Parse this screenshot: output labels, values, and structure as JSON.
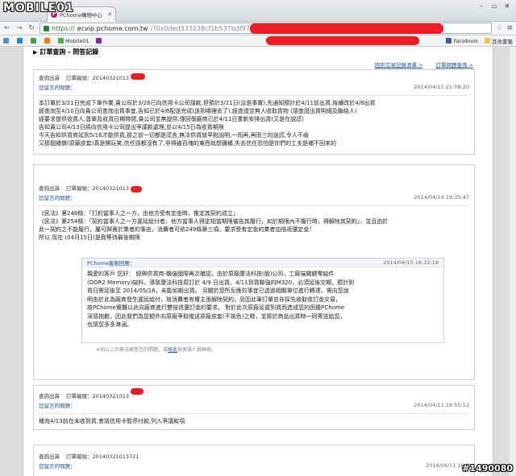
{
  "watermark": {
    "logo": "MOBILE01",
    "id": "#1490080"
  },
  "browser": {
    "tab_title": "PChome購物中心",
    "tab_favicon": "P",
    "url_scheme": "https://",
    "url_host": "ecvip.pchome.com.tw",
    "url_rest": "/?0x0ded333238cf1b537bdf971253aa19c2372a6d31ceef06fd727a6bd84c",
    "bookmarks": [
      {
        "label": "",
        "color": "#4a90d9"
      },
      {
        "label": "",
        "color": "#1e88e5"
      },
      {
        "label": "",
        "color": "#43a047"
      },
      {
        "label": "",
        "color": "#f57c00"
      },
      {
        "label": "Mobile01",
        "color": "#4caf50"
      },
      {
        "label": "",
        "color": "#8e24aa"
      },
      {
        "label": "Facebook",
        "color": "#3b5998"
      },
      {
        "label": "其他書籤",
        "color": "#f5c542"
      }
    ]
  },
  "page": {
    "title": "訂單查詢 - 問答記錄",
    "link_more": "回到交易記錄清單 >",
    "link_faq": "訂單問題查詢 >"
  },
  "cards": [
    {
      "order_label": "查詢出貨",
      "order_id_label": "訂單編號：20140321013",
      "question_label": "您留言的問題：",
      "timestamp": "2014/04/15 21:58:20",
      "lines": [
        "本訂單於3/21日完成下單作業,貴公司於3/26已向信用卡公司請款,但預計3/21日(這是事實),先通知預計於4/11前出貨,後續改於4/8出貨",
        "經查詢至4/10日向貴公司查詢出貨事宜,告知已於4/8配送完成(送到哪裡去了),經查證並無人收取貨物 (請查證出貨明細及聯絡人)",
        "經要求提供收貨人,簽單及收貨日期時間,貴公司並無提供,僅回復廠商已於4/11日重新安排出貨(又是在說謊)",
        "告知貴公司4/13日將向信用卡公司提出爭議款處理,並以4/15日為收貨期限",
        "今天告知供貨商延到5/16才能供貨,那之前一切都是謊言,無法供貨就早點說明,一而再,再而三的說謊,令人不齒",
        "又那個補償(原廠皮套)真是開玩笑,信任感都沒有了,非得幾百塊的東西就想彌補,失去信任恐怕是你們的工夫是補不回來的"
      ]
    },
    {
      "order_label": "查詢出貨",
      "order_id_label": "訂單編號：20140321013",
      "question_label": "您留言的問題：",
      "timestamp": "2014/04/14 19:35:47",
      "lines": [
        "《民法》第248條：「訂約當事人之一方，由他方受有定金時，推定其契約成立」",
        "《民法》第254條：「契約當事人之一方遲延給付者，他方當事人得定相當期限催告其履行，如於期限內不履行時，得解除其契約」，並且由於",
        "此一契約之不能履行，屬可歸責於業者的事由，消費者可依249條第三項，要求受有定金的業者加倍返還定金！",
        "所以 现在 (04月15日)是我等待最後期限"
      ],
      "reply": {
        "label": "PChome客服回應：",
        "timestamp": "2014/04/15 18:22:18",
        "lines": [
          "親愛的客戶 您好： 經與供貨商-聯強國際再次確認，由於原廠康法科技(股)公司，工廠端關鍵零組件",
          "(DDR2 Memory)缺料，導致康法科技原訂於 4/9 日出貨、4/11到貨聯強的M320，必須延後交期，預計到",
          "貨日需延後至 2014/05/16，未能如期出貨。 另關於您所反應的事宜已透過相關單位進行轉達，需向您說",
          "明由於此為廠商發生遲延給付，故消費者有權主張解除契約，另因此筆訂單並非採先收取收訂金交易，",
          "故PChome實難以此向廠商進行雙倍退還訂金的要求。 對於此次原廠延遲到貨而造成您的困擾PChome",
          "深感抱歉，因此我們為您額外向原廠爭取贈送原廠皮套(不挑色)之贈，並將於商品出貨時一同寄送給您，",
          "也請您多多海涵。"
        ],
        "notice": "※如以上仍無法解答您的問題，請",
        "notice_link": "按此",
        "notice_tail": "與客服人員聯絡。"
      }
    },
    {
      "order_label": "查詢出貨",
      "order_id_label": "訂單編號：20140321013",
      "question_label": "您留言的問題：",
      "timestamp": "2014/04/11 18:55:52",
      "lines": [
        "補充4/13前在未收到貨,會請信用卡暫停付款,列入爭議款項"
      ]
    },
    {
      "order_label": "查詢出貨",
      "order_id_label": "訂單編號：20140321013721",
      "question_label": "您留言的問題：",
      "timestamp": "2014/04/11 18:4",
      "lines": []
    }
  ]
}
